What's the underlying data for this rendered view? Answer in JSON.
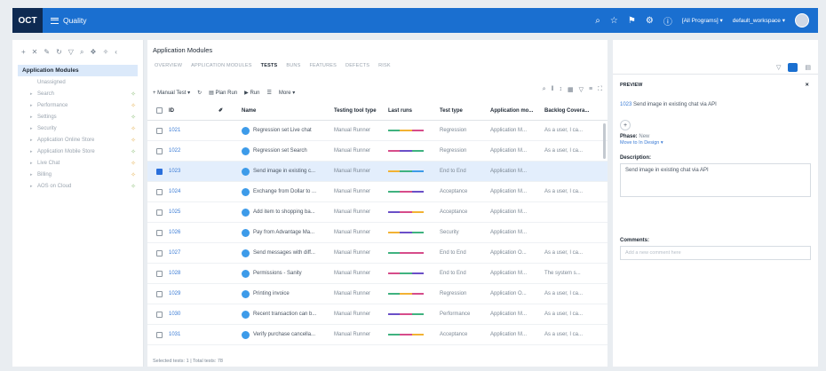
{
  "topbar": {
    "logo": "OCT",
    "module": "Quality",
    "program_selector": "[All Programs]",
    "workspace_selector": "default_workspace"
  },
  "tree": {
    "root": "Application Modules",
    "items": [
      {
        "label": "Unassigned"
      },
      {
        "label": "Search"
      },
      {
        "label": "Performance"
      },
      {
        "label": "Settings"
      },
      {
        "label": "Security"
      },
      {
        "label": "Application Online Store"
      },
      {
        "label": "Application Mobile Store"
      },
      {
        "label": "Live Chat"
      },
      {
        "label": "Billing"
      },
      {
        "label": "AOS on Cloud"
      }
    ]
  },
  "main": {
    "title": "Application Modules",
    "tabs": [
      "OVERVIEW",
      "APPLICATION MODULES",
      "TESTS",
      "BUNS",
      "FEATURES",
      "DEFECTS",
      "RISK"
    ],
    "active_tab": "TESTS",
    "toolbar": {
      "new_test": "+ Manual Test",
      "plan_run": "Plan Run",
      "run": "Run",
      "more": "More"
    },
    "columns": [
      "ID",
      "Name",
      "Testing tool type",
      "Last runs",
      "Test type",
      "Application mo...",
      "Backlog Covera..."
    ],
    "rows": [
      {
        "id": "1021",
        "name": "Regression set Live chat",
        "tool": "Manual Runner",
        "type": "Regression",
        "app": "Application M...",
        "backlog": "As a user, I ca...",
        "selected": false
      },
      {
        "id": "1022",
        "name": "Regression set Search",
        "tool": "Manual Runner",
        "type": "Regression",
        "app": "Application M...",
        "backlog": "As a user, I ca...",
        "selected": false
      },
      {
        "id": "1023",
        "name": "Send image in existing c...",
        "tool": "Manual Runner",
        "type": "End to End",
        "app": "Application M...",
        "backlog": "",
        "selected": true
      },
      {
        "id": "1024",
        "name": "Exchange from Dollar to ...",
        "tool": "Manual Runner",
        "type": "Acceptance",
        "app": "Application M...",
        "backlog": "As a user, I ca...",
        "selected": false
      },
      {
        "id": "1025",
        "name": "Add item to shopping ba...",
        "tool": "Manual Runner",
        "type": "Acceptance",
        "app": "Application M...",
        "backlog": "",
        "selected": false
      },
      {
        "id": "1026",
        "name": "Pay from Advantage Ma...",
        "tool": "Manual Runner",
        "type": "Security",
        "app": "Application M...",
        "backlog": "",
        "selected": false
      },
      {
        "id": "1027",
        "name": "Send messages with diff...",
        "tool": "Manual Runner",
        "type": "End to End",
        "app": "Application O...",
        "backlog": "As a user, I ca...",
        "selected": false
      },
      {
        "id": "1028",
        "name": "Permissions - Sanity",
        "tool": "Manual Runner",
        "type": "End to End",
        "app": "Application M...",
        "backlog": "The system s...",
        "selected": false
      },
      {
        "id": "1029",
        "name": "Printing invoice",
        "tool": "Manual Runner",
        "type": "Regression",
        "app": "Application O...",
        "backlog": "As a user, I ca...",
        "selected": false
      },
      {
        "id": "1030",
        "name": "Recent transaction can b...",
        "tool": "Manual Runner",
        "type": "Performance",
        "app": "Application M...",
        "backlog": "As a user, I ca...",
        "selected": false
      },
      {
        "id": "1031",
        "name": "Verify purchase cancella...",
        "tool": "Manual Runner",
        "type": "Acceptance",
        "app": "Application M...",
        "backlog": "As a user, I ca...",
        "selected": false
      }
    ],
    "status": "Selected tests: 1 | Total tests: 78"
  },
  "preview": {
    "header": "PREVIEW",
    "item_id": "1023",
    "item_title": "Send image in existing chat via API",
    "phase_label": "Phase:",
    "phase_value": "New",
    "move_link": "Move to In Design",
    "description_label": "Description:",
    "description": "Send image in existing chat via API",
    "comments_label": "Comments:",
    "comments_placeholder": "Add a new comment here"
  },
  "colors": {
    "topbar": "#1a6fd0",
    "logo_bg": "#0e2a52",
    "selected_row": "#e3eefc",
    "link": "#3a7bd5"
  }
}
